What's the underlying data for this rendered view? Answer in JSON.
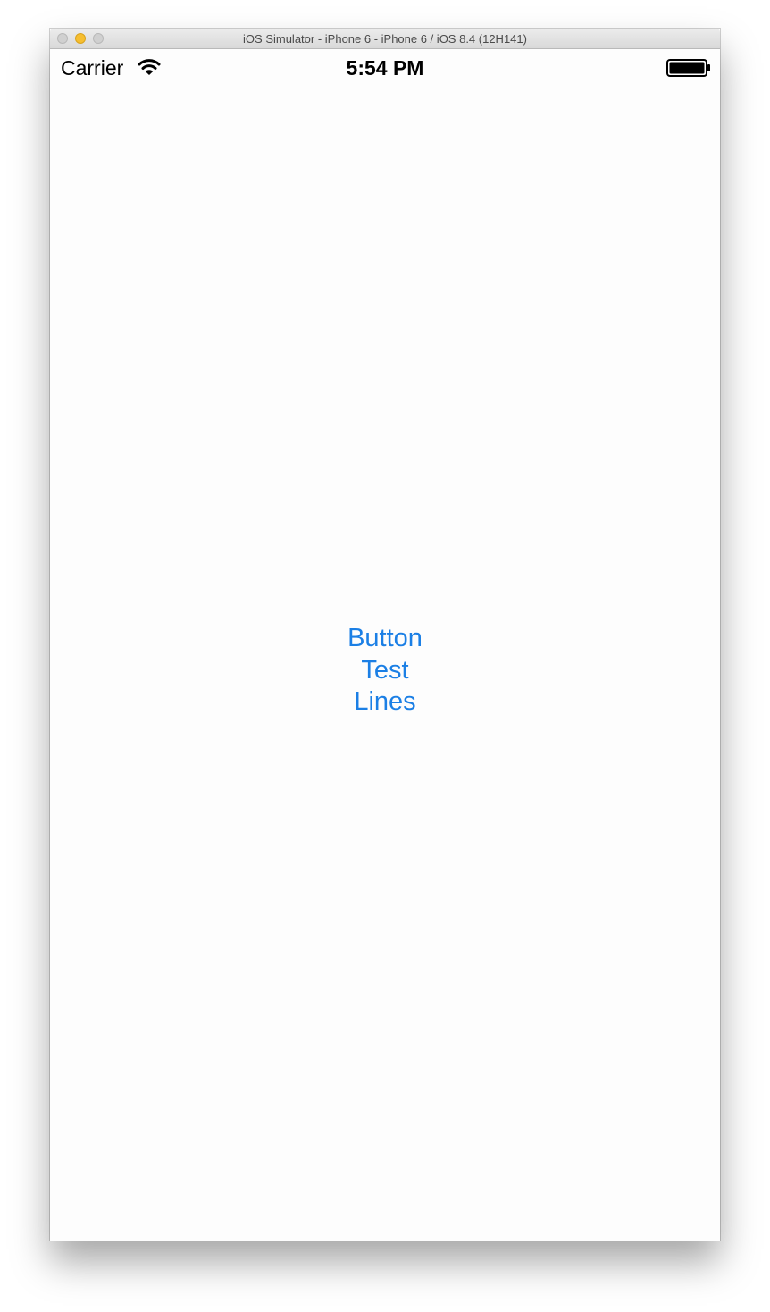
{
  "window": {
    "title": "iOS Simulator - iPhone 6 - iPhone 6 / iOS 8.4 (12H141)"
  },
  "status_bar": {
    "carrier": "Carrier",
    "time": "5:54 PM",
    "icons": [
      "wifi-icon",
      "battery-icon"
    ]
  },
  "main": {
    "button_lines": [
      "Button",
      "Test",
      "Lines"
    ]
  },
  "colors": {
    "button_tint": "#1b7fe5",
    "minimize_button": "#f6be30"
  }
}
